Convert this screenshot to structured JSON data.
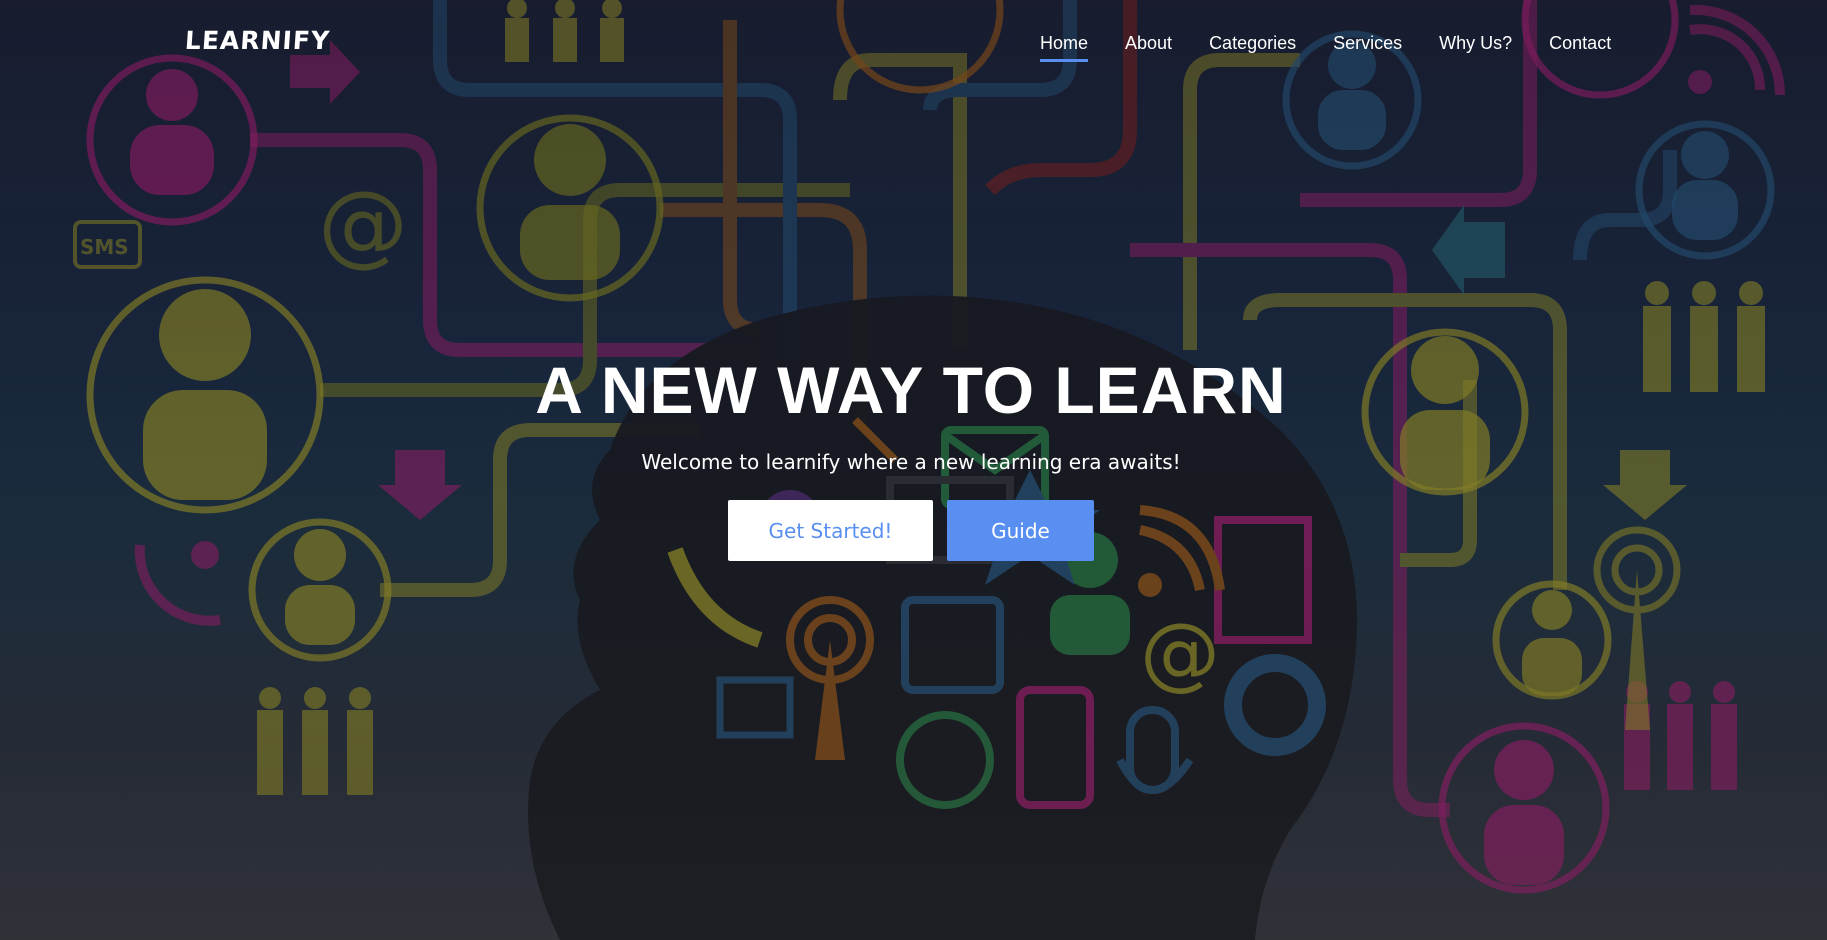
{
  "brand": {
    "logo_text": "LEARNIFY"
  },
  "nav": {
    "items": [
      {
        "label": "Home",
        "active": true
      },
      {
        "label": "About",
        "active": false
      },
      {
        "label": "Categories",
        "active": false
      },
      {
        "label": "Services",
        "active": false
      },
      {
        "label": "Why Us?",
        "active": false
      },
      {
        "label": "Contact",
        "active": false
      }
    ]
  },
  "hero": {
    "title": "A NEW WAY TO LEARN",
    "subtitle": "Welcome to learnify where a new learning era awaits!",
    "primary_button": "Get Started!",
    "secondary_button": "Guide",
    "background_image": "head-silhouette-network-icons"
  },
  "colors": {
    "accent": "#5a8ff2",
    "text": "#ffffff"
  }
}
